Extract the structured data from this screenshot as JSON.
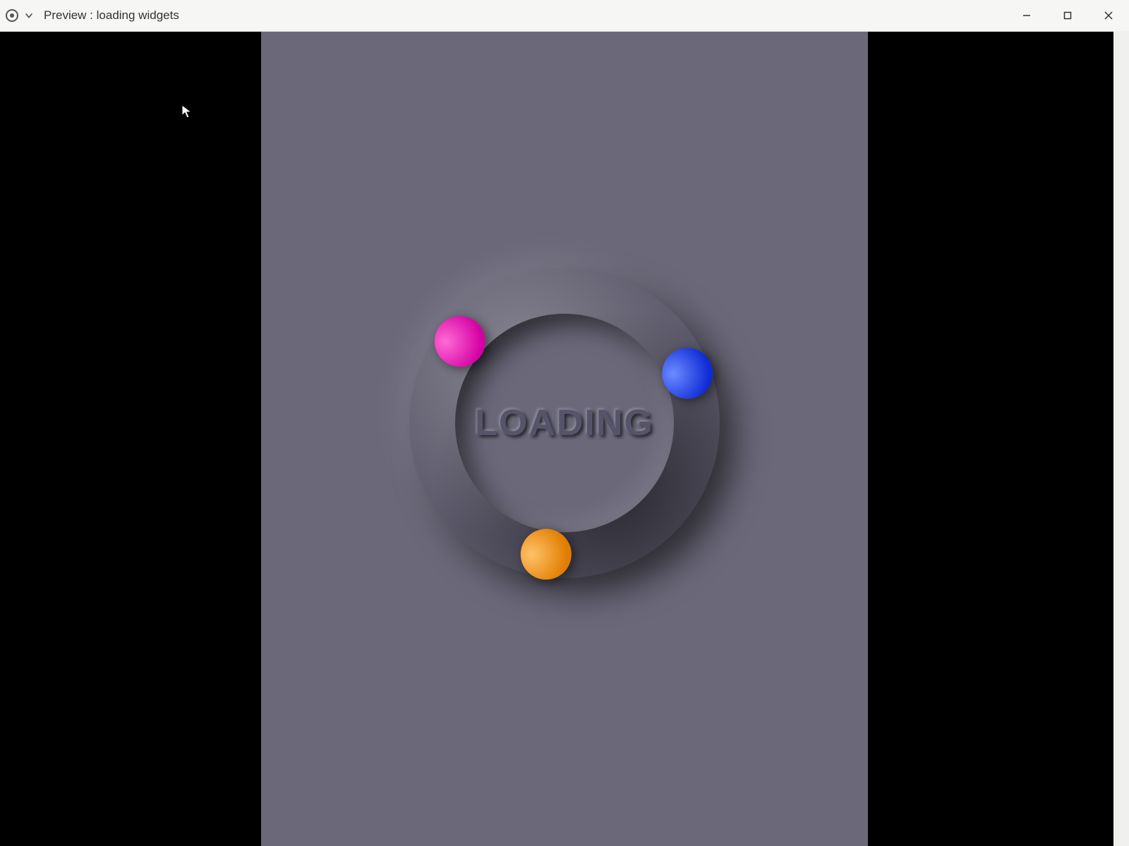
{
  "window": {
    "title": "Preview : loading widgets"
  },
  "spinner": {
    "label": "LOADING",
    "balls": [
      {
        "name": "pink",
        "color_light": "#ff6ad5",
        "color_dark": "#d400a3"
      },
      {
        "name": "blue",
        "color_light": "#6b8bff",
        "color_dark": "#0f2bd6"
      },
      {
        "name": "orange",
        "color_light": "#ffc268",
        "color_dark": "#e07c00"
      }
    ]
  },
  "colors": {
    "stage_bg": "#6a6879",
    "ring_bg": "#5c5a6b"
  }
}
